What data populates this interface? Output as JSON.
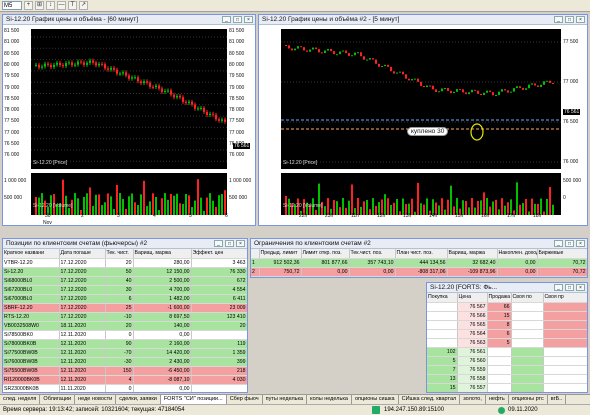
{
  "toolbar": {
    "timeframe": "M5",
    "buttons": [
      "+",
      "⊞",
      "↕",
      "—",
      "T",
      "↗"
    ]
  },
  "win1": {
    "title": "Si-12.20 График цены и объёма - [60 минут]",
    "y_left": [
      "81 500",
      "81 000",
      "80 500",
      "80 000",
      "79 500",
      "79 000",
      "78 500",
      "78 000",
      "77 500",
      "77 000",
      "76 500",
      "76 000"
    ],
    "y_right": [
      "81 500",
      "81 000",
      "80 500",
      "80 000",
      "79 500",
      "79 000",
      "78 500",
      "78 000",
      "77 500",
      "77 000",
      "76 500",
      "76 000"
    ],
    "price_tag": "76 561",
    "price_label": "Si-12.20 [Price]",
    "vol_left": [
      "1 000 000",
      "500 000",
      "0"
    ],
    "vol_right": [
      "1 000 000",
      "500 000",
      "0"
    ],
    "vol_label": "Si-12.20 [Volume]",
    "x": [
      "30",
      "2",
      "3",
      "4",
      "5",
      "6"
    ],
    "x_month": "Nov"
  },
  "win2": {
    "title": "Si-12.20 График цены и объёма #2 - [5 минут]",
    "y": [
      "77 500",
      "77 000",
      "76 500",
      "76 000"
    ],
    "price_tag": "76 561",
    "price_label": "Si-12.20 [Price]",
    "annotation": "куплено 30",
    "vol": [
      "500 000",
      "0"
    ],
    "vol_label": "Si-12.20 [Volume]",
    "x": [
      "22h",
      "23h",
      "11h",
      "12h",
      "13h",
      "14h",
      "15h",
      "16h",
      "17h",
      "18h"
    ]
  },
  "positions": {
    "title": "Позиции по клиентским счетам (фьючерсы) #2",
    "headers": [
      "Краткое названи",
      "Дата погаше",
      "Тек. чист.",
      "Вариац. маржа",
      "Эффект. цен"
    ],
    "rows": [
      {
        "c": "w",
        "v": [
          "VTBR-12.20",
          "17.12.2020",
          "20",
          "280,00",
          "3 463"
        ]
      },
      {
        "c": "g",
        "v": [
          "Si-12.20",
          "17.12.2020",
          "50",
          "12 150,00",
          "76 330"
        ]
      },
      {
        "c": "g",
        "v": [
          "Si68000BL0",
          "17.12.2020",
          "40",
          "2 500,00",
          "672"
        ]
      },
      {
        "c": "g",
        "v": [
          "Si67200BL0",
          "17.12.2020",
          "30",
          "4 700,00",
          "4 554"
        ]
      },
      {
        "c": "g",
        "v": [
          "Si67000BL0",
          "17.12.2020",
          "6",
          "1 482,00",
          "6 411"
        ]
      },
      {
        "c": "r",
        "v": [
          "SBRF-12.20",
          "17.12.2020",
          "25",
          "-1 600,00",
          "23 009"
        ]
      },
      {
        "c": "g",
        "v": [
          "RTS-12.20",
          "17.12.2020",
          "-10",
          "8 697,50",
          "123 410"
        ]
      },
      {
        "c": "g",
        "v": [
          "VB0032508W0",
          "18.11.2020",
          "20",
          "140,00",
          "20"
        ]
      },
      {
        "c": "w",
        "v": [
          "Si78500BK0",
          "12.11.2020",
          "0",
          "0,00",
          ""
        ]
      },
      {
        "c": "g",
        "v": [
          "Si78000BK0B",
          "12.11.2020",
          "90",
          "2 160,00",
          "119"
        ]
      },
      {
        "c": "g",
        "v": [
          "Si77500BW0B",
          "12.11.2020",
          "-70",
          "14 420,00",
          "1 359"
        ]
      },
      {
        "c": "g",
        "v": [
          "Si76000BW0B",
          "12.11.2020",
          "-30",
          "2 430,00",
          "399"
        ]
      },
      {
        "c": "r",
        "v": [
          "Si75500BW0B",
          "12.11.2020",
          "150",
          "-6 450,00",
          "218"
        ]
      },
      {
        "c": "r",
        "v": [
          "RI120000BK0B",
          "12.11.2020",
          "4",
          "-8 087,10",
          "4 030"
        ]
      },
      {
        "c": "w",
        "v": [
          "SR23000BK0B",
          "11.11.2020",
          "0",
          "0,00",
          ""
        ]
      }
    ]
  },
  "limits": {
    "title": "Ограничения по клиентским счетам #2",
    "headers": [
      "",
      "Предыд. лимит",
      "Лимит откр. поз.",
      "Тек.чист. поз.",
      "План чист. поз.",
      "Вариац. маржа",
      "Накоплен. доход",
      "Биржевые"
    ],
    "rows": [
      {
        "c": "g",
        "v": [
          "1",
          "912 502,36",
          "801 877,66",
          "357 743,10",
          "444 134,56",
          "32 682,40",
          "0,00",
          "70,72"
        ]
      },
      {
        "c": "r",
        "v": [
          "2",
          "750,72",
          "0,00",
          "0,00",
          "-808 317,06",
          "-109 873,96",
          "0,00",
          "70,72"
        ]
      }
    ]
  },
  "quotes": {
    "title": "Si-12.20 [FORTS: Фь...",
    "headers": [
      "Покупка",
      "Цена",
      "Продажа",
      "Своя по",
      "Своя пр"
    ],
    "rows": [
      {
        "buy": "",
        "price": "76 567",
        "sell": "66"
      },
      {
        "buy": "",
        "price": "76 566",
        "sell": "15"
      },
      {
        "buy": "",
        "price": "76 565",
        "sell": "8"
      },
      {
        "buy": "",
        "price": "76 564",
        "sell": "6"
      },
      {
        "buy": "",
        "price": "76 563",
        "sell": "5"
      },
      {
        "buy": "102",
        "price": "76 561",
        "sell": ""
      },
      {
        "buy": "5",
        "price": "76 560",
        "sell": ""
      },
      {
        "buy": "7",
        "price": "76 559",
        "sell": ""
      },
      {
        "buy": "13",
        "price": "76 558",
        "sell": ""
      },
      {
        "buy": "15",
        "price": "76 557",
        "sell": ""
      }
    ]
  },
  "tabs": [
    "след. неделя",
    "Облигации",
    "неде новости",
    "сделки, заявки",
    "FORTS \"СИ\" позиции...",
    "Сбер фьюч",
    "путы неделька",
    "колы неделька",
    "опционы сишка",
    "СИшка след. квартал",
    "золото,",
    "нефть",
    "опционы ртс",
    "вгБ.."
  ],
  "status": {
    "left": "Время сервера: 19:13:42; записей: 10321604; текущая: 47184054",
    "ip": "194.247.150.89:15100",
    "date": "09.11.2020"
  },
  "colors": {
    "up": "#00c000",
    "down": "#ff2020",
    "buy": "#a8e4a0",
    "sell": "#f4a0a0"
  }
}
